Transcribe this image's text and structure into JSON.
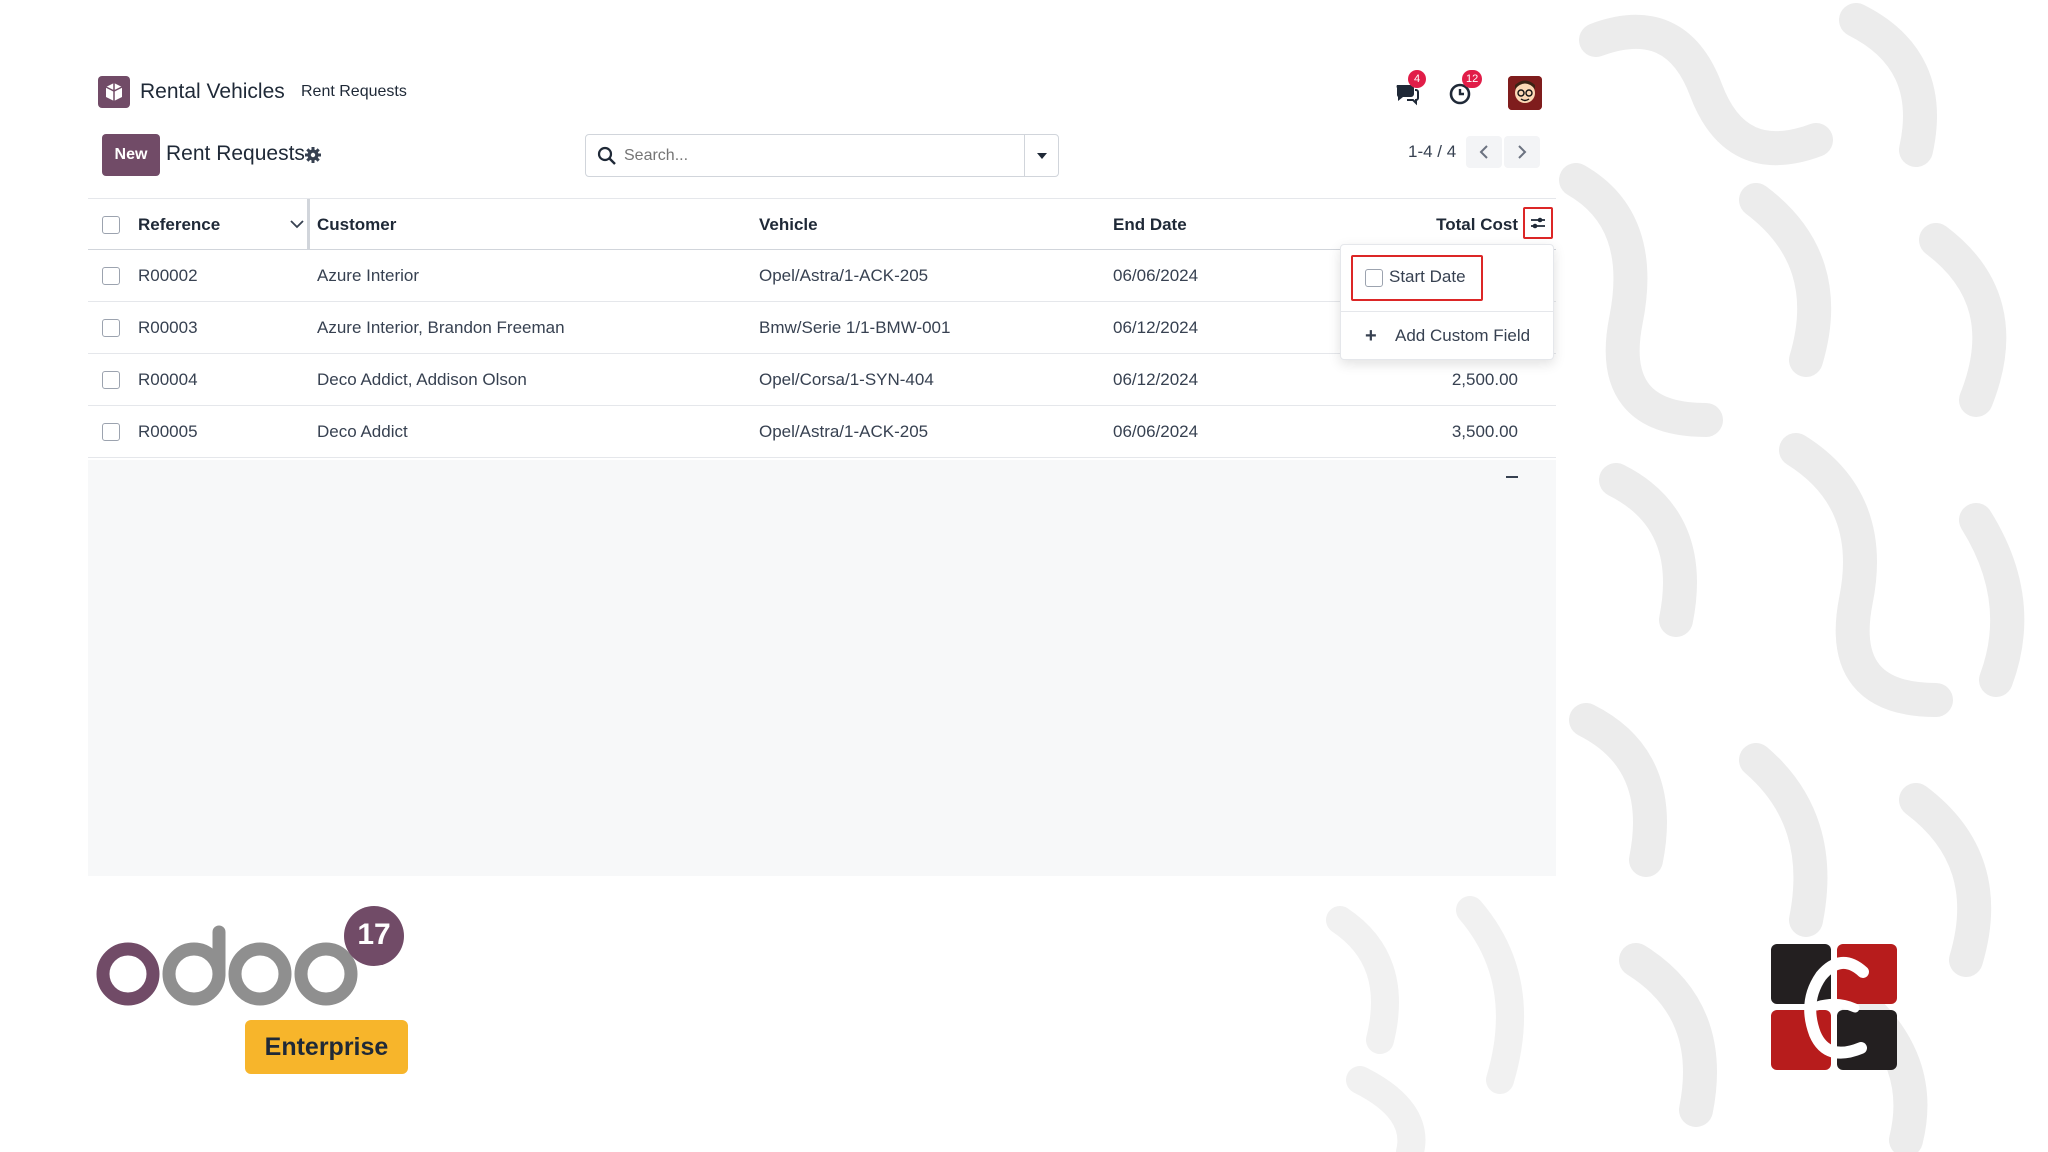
{
  "navbar": {
    "app_name": "Rental Vehicles",
    "menu_item": "Rent Requests",
    "messages_count": "4",
    "activities_count": "12"
  },
  "control_panel": {
    "new_button": "New",
    "title": "Rent Requests",
    "search_placeholder": "Search...",
    "pager": "1-4 / 4"
  },
  "table": {
    "columns": [
      "Reference",
      "Customer",
      "Vehicle",
      "End Date",
      "Total Cost"
    ],
    "rows": [
      {
        "reference": "R00002",
        "customer": "Azure Interior",
        "vehicle": "Opel/Astra/1-ACK-205",
        "end_date": "06/06/2024",
        "total": ""
      },
      {
        "reference": "R00003",
        "customer": "Azure Interior, Brandon Freeman",
        "vehicle": "Bmw/Serie 1/1-BMW-001",
        "end_date": "06/12/2024",
        "total": ""
      },
      {
        "reference": "R00004",
        "customer": "Deco Addict, Addison Olson",
        "vehicle": "Opel/Corsa/1-SYN-404",
        "end_date": "06/12/2024",
        "total": "2,500.00"
      },
      {
        "reference": "R00005",
        "customer": "Deco Addict",
        "vehicle": "Opel/Astra/1-ACK-205",
        "end_date": "06/06/2024",
        "total": "3,500.00"
      }
    ]
  },
  "optional_columns": {
    "start_date": "Start Date",
    "add_custom_field": "Add Custom Field"
  },
  "branding": {
    "version": "17",
    "edition": "Enterprise"
  },
  "colors": {
    "brand": "#714b67",
    "badge": "#e11d48",
    "highlight": "#dc2626",
    "enterprise": "#f7b52b"
  }
}
